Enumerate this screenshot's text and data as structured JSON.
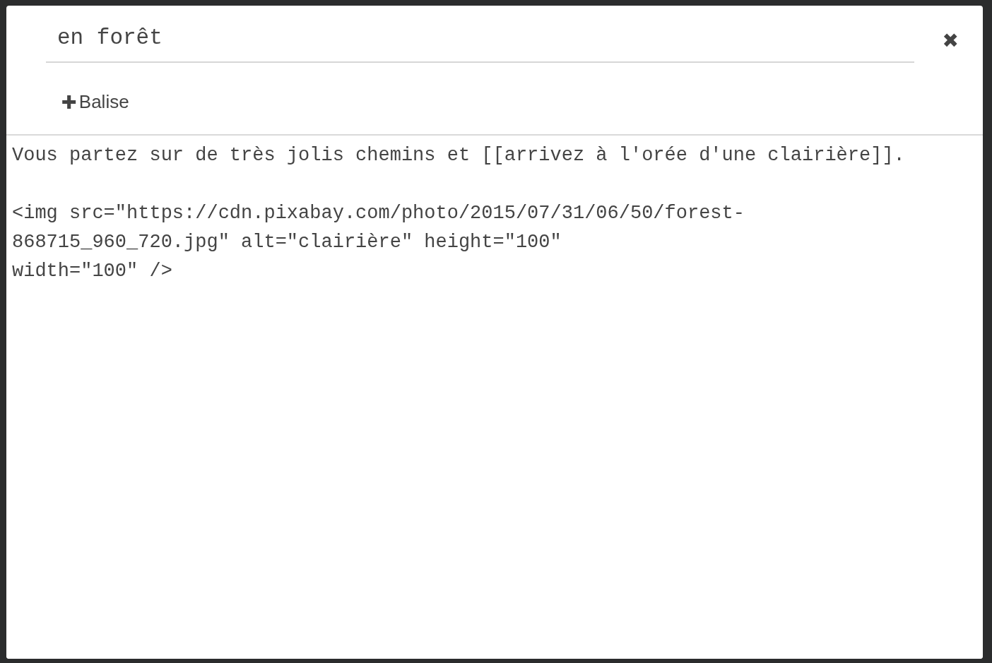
{
  "dialog": {
    "title_field": {
      "value": "en forêt"
    },
    "close_label": "✖",
    "add_tag_button": {
      "icon": "✚",
      "label": "Balise"
    },
    "editor": {
      "value": "Vous partez sur de très jolis chemins et [[arrivez à l'orée d'une clairière]].\n\n<img src=\"https://cdn.pixabay.com/photo/2015/07/31/06/50/forest-868715_960_720.jpg\" alt=\"clairière\" height=\"100\"\nwidth=\"100\" />"
    }
  }
}
